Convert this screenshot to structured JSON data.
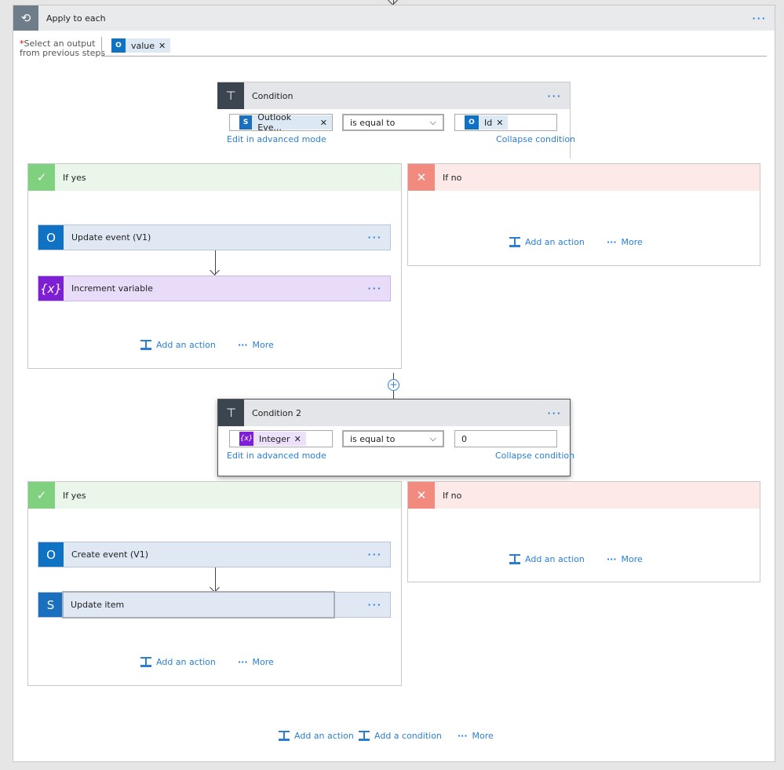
{
  "apply": {
    "title": "Apply to each",
    "required_mark": "*",
    "select_label_1": "Select an output",
    "select_label_2": "from previous steps",
    "token": "value",
    "menu": "···"
  },
  "condition1": {
    "title": "Condition",
    "left_token": "Outlook Eve...",
    "operator": "is equal to",
    "right_token": "Id",
    "edit_link": "Edit in advanced mode",
    "collapse_link": "Collapse condition",
    "menu": "···"
  },
  "yes1": {
    "title": "If yes",
    "actions": [
      {
        "title": "Update event (V1)",
        "menu": "···"
      },
      {
        "title": "Increment variable",
        "menu": "···"
      }
    ],
    "add_action": "Add an action",
    "more": "More"
  },
  "no1": {
    "title": "If no",
    "add_action": "Add an action",
    "more": "More"
  },
  "condition2": {
    "title": "Condition 2",
    "left_token": "Integer",
    "operator": "is equal to",
    "right_value": "0",
    "edit_link": "Edit in advanced mode",
    "collapse_link": "Collapse condition",
    "menu": "···"
  },
  "yes2": {
    "title": "If yes",
    "actions": [
      {
        "title": "Create event (V1)",
        "menu": "···"
      },
      {
        "title": "Update item",
        "menu": "···"
      }
    ],
    "add_action": "Add an action",
    "more": "More"
  },
  "no2": {
    "title": "If no",
    "add_action": "Add an action",
    "more": "More"
  },
  "footer": {
    "add_action": "Add an action",
    "add_condition": "Add a condition",
    "more": "More"
  },
  "colors": {
    "accent": "#2a7fd4",
    "outlook": "#0f72c3",
    "variable": "#7f1fd3",
    "yes": "#7fd17f",
    "no": "#f28a80",
    "sharepoint": "#1a6fbf"
  }
}
